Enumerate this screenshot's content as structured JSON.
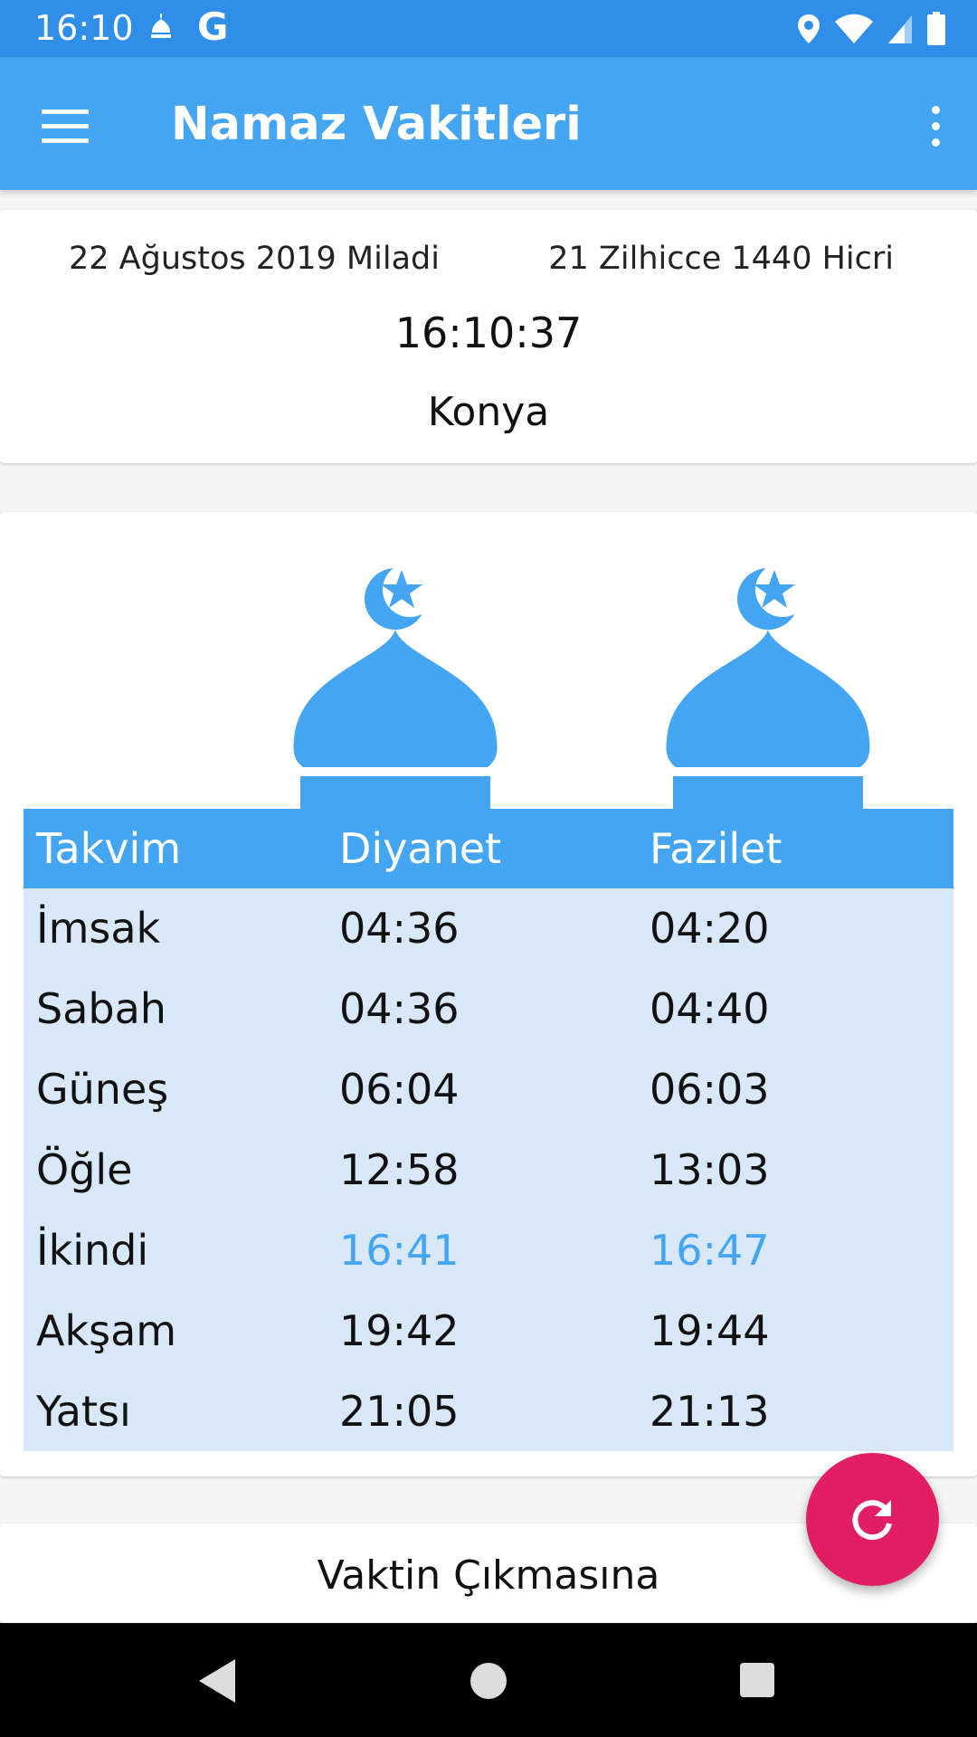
{
  "status_bar": {
    "time": "16:10",
    "g_letter": "G",
    "icons": [
      "mosque-icon",
      "google-icon",
      "location-icon",
      "wifi-icon",
      "signal-icon",
      "battery-icon"
    ]
  },
  "app_bar": {
    "title": "Namaz Vakitleri",
    "menu_icon": "hamburger-menu-icon",
    "overflow_icon": "more-vert-icon"
  },
  "date_card": {
    "gregorian": "22 Ağustos 2019 Miladi",
    "hijri": "21 Zilhicce 1440 Hicri",
    "clock": "16:10:37",
    "city": "Konya"
  },
  "times_table": {
    "headers": [
      "Takvim",
      "Diyanet",
      "Fazilet"
    ],
    "rows": [
      {
        "name": "İmsak",
        "diyanet": "04:36",
        "fazilet": "04:20",
        "highlight": false
      },
      {
        "name": "Sabah",
        "diyanet": "04:36",
        "fazilet": "04:40",
        "highlight": false
      },
      {
        "name": "Güneş",
        "diyanet": "06:04",
        "fazilet": "06:03",
        "highlight": false
      },
      {
        "name": "Öğle",
        "diyanet": "12:58",
        "fazilet": "13:03",
        "highlight": false
      },
      {
        "name": "İkindi",
        "diyanet": "16:41",
        "fazilet": "16:47",
        "highlight": true
      },
      {
        "name": "Akşam",
        "diyanet": "19:42",
        "fazilet": "19:44",
        "highlight": false
      },
      {
        "name": "Yatsı",
        "diyanet": "21:05",
        "fazilet": "21:13",
        "highlight": false
      }
    ]
  },
  "remaining_card": {
    "title": "Vaktin Çıkmasına"
  },
  "fab": {
    "icon": "refresh-icon"
  },
  "colors": {
    "status_bar": "#2f8ee8",
    "app_bar": "#44a5f3",
    "table_body": "#d9e8f8",
    "highlight": "#44a5f3",
    "fab": "#e11d63"
  }
}
